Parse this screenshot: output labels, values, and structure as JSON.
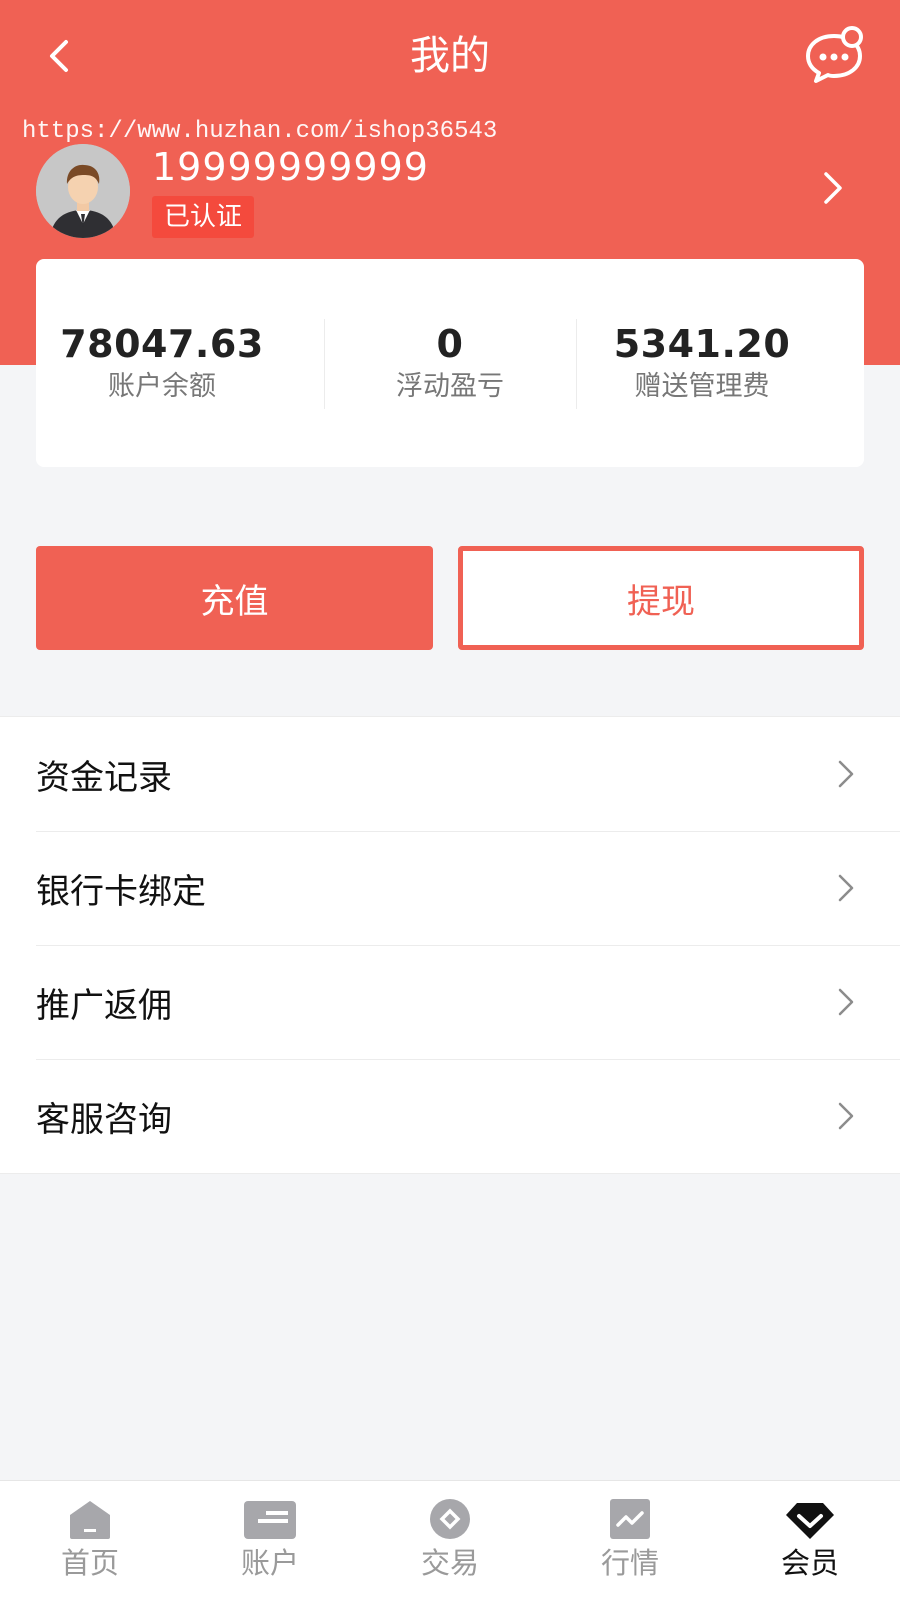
{
  "header": {
    "title": "我的",
    "back_icon": "chevron-left-icon",
    "message_icon": "chat-bubble-icon",
    "watermark": "https://www.huzhan.com/ishop36543",
    "background_color": "#f06154"
  },
  "profile": {
    "avatar_icon": "user-avatar",
    "phone": "19999999999",
    "verified_label": "已认证"
  },
  "stats": [
    {
      "value": "78047.63",
      "label": "账户余额"
    },
    {
      "value": "0",
      "label": "浮动盈亏"
    },
    {
      "value": "5341.20",
      "label": "赠送管理费"
    }
  ],
  "actions": {
    "recharge_label": "充值",
    "withdraw_label": "提现",
    "accent_color": "#f06154"
  },
  "menu": [
    {
      "label": "资金记录"
    },
    {
      "label": "银行卡绑定"
    },
    {
      "label": "推广返佣"
    },
    {
      "label": "客服咨询"
    }
  ],
  "tabbar": [
    {
      "label": "首页",
      "icon": "home-icon",
      "active": false
    },
    {
      "label": "账户",
      "icon": "card-icon",
      "active": false
    },
    {
      "label": "交易",
      "icon": "trade-icon",
      "active": false
    },
    {
      "label": "行情",
      "icon": "chart-icon",
      "active": false
    },
    {
      "label": "会员",
      "icon": "member-icon",
      "active": true
    }
  ]
}
